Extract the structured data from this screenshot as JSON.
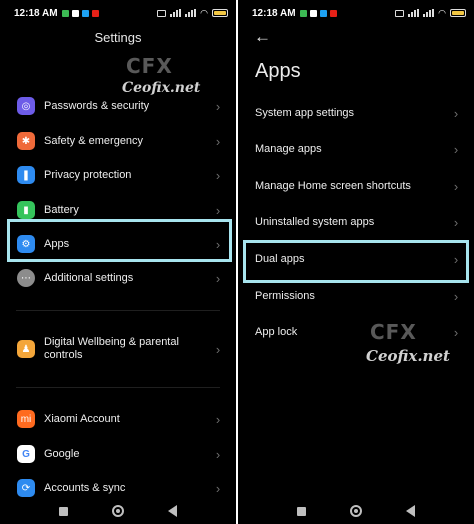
{
  "status": {
    "time": "12:18 AM",
    "battery_label": "battery-icon",
    "wifi_label": "wifi-icon"
  },
  "colors": {
    "highlight": "#a7e4ee",
    "background": "#000000",
    "passwords": "#6d5ce8",
    "safety": "#ef6a3a",
    "privacy": "#2e8bf0",
    "battery": "#35c45c",
    "apps": "#2e8bf0",
    "additional": "#8c8c8c",
    "wellbeing": "#f4a63a",
    "xiaomi": "#ff6a1f",
    "google": "#ffffff",
    "accounts": "#2e8bf0"
  },
  "left": {
    "title": "Settings",
    "watermark": "Ceofix.net",
    "logo": "CFX",
    "items": [
      {
        "label": "Passwords & security"
      },
      {
        "label": "Safety & emergency"
      },
      {
        "label": "Privacy protection"
      },
      {
        "label": "Battery"
      },
      {
        "label": "Apps"
      },
      {
        "label": "Additional settings"
      },
      {
        "label": "Digital Wellbeing & parental controls"
      },
      {
        "label": "Xiaomi Account"
      },
      {
        "label": "Google"
      },
      {
        "label": "Accounts & sync"
      }
    ]
  },
  "right": {
    "title": "Apps",
    "watermark": "Ceofix.net",
    "logo": "CFX",
    "items": [
      {
        "label": "System app settings"
      },
      {
        "label": "Manage apps"
      },
      {
        "label": "Manage Home screen shortcuts"
      },
      {
        "label": "Uninstalled system apps"
      },
      {
        "label": "Dual apps"
      },
      {
        "label": "Permissions"
      },
      {
        "label": "App lock"
      }
    ]
  },
  "icons": {
    "chevron": "›",
    "back": "←"
  }
}
